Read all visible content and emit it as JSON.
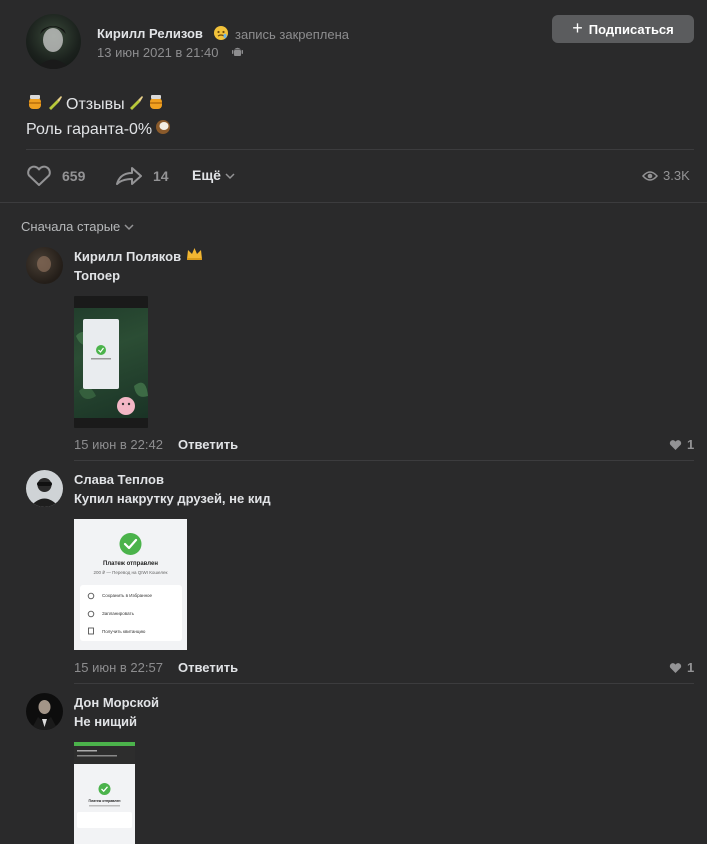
{
  "post": {
    "author": "Кирилл Релизов",
    "pinned_label": "запись закреплена",
    "date": "13 июн 2021 в 21:40",
    "subscribe_label": "Подписаться",
    "line1_text": "Отзывы",
    "line2_text": "Роль гаранта-0%",
    "likes": "659",
    "shares": "14",
    "more_label": "Ещё",
    "views": "3.3K"
  },
  "sort_label": "Сначала старые",
  "comments": [
    {
      "author": "Кирилл Поляков",
      "text": "Топоер",
      "date": "15 июн в 22:42",
      "reply_label": "Ответить",
      "likes": "1"
    },
    {
      "author": "Слава Теплов",
      "text": "Купил накрутку друзей, не кид",
      "date": "15 июн в 22:57",
      "reply_label": "Ответить",
      "likes": "1",
      "image": {
        "title": "Платеж отправлен",
        "subtitle": "200 ₽ — Перевод на QIWI Кошелек",
        "items": [
          "Сохранить в Избранное",
          "Запланировать",
          "Получить квитанцию"
        ]
      }
    },
    {
      "author": "Дон Морской",
      "text": "Не нищий",
      "image": {
        "title": "Платеж отправлен"
      }
    }
  ],
  "colors": {
    "background": "#2a2a2b",
    "button": "#5b5c5e",
    "success": "#4bb34b"
  }
}
